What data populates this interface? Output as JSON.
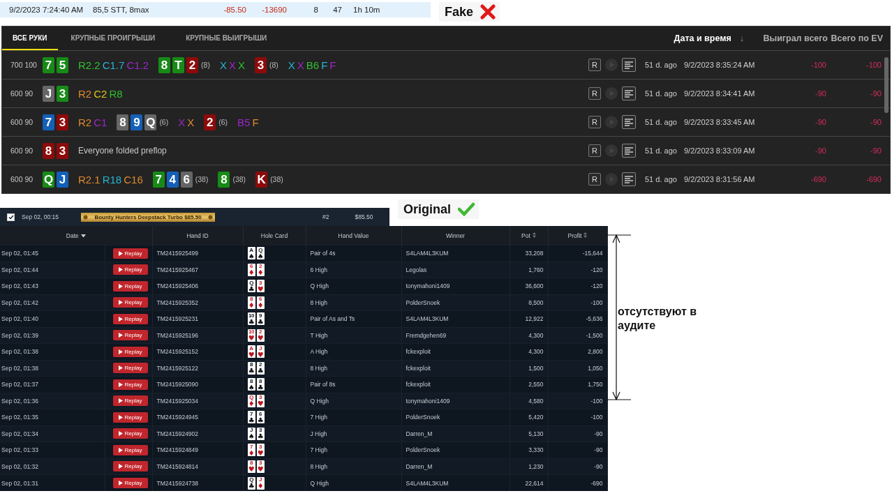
{
  "summary": {
    "date": "9/2/2023 7:24:40 AM",
    "game": "85,5 STT, 8max",
    "amount": "-85.50",
    "result": "-13690",
    "col_5": "8",
    "col_6": "47",
    "duration": "1h 10m"
  },
  "fake_label": {
    "text": "Fake",
    "kind": "cross"
  },
  "fake_panel": {
    "tabs": [
      {
        "label": "ВСЕ РУКИ",
        "selected": true
      },
      {
        "label": "КРУПНЫЕ ПРОИГРЫШИ",
        "selected": false
      },
      {
        "label": "КРУПНЫЕ ВЫИГРЫШИ",
        "selected": false
      }
    ],
    "columns": [
      {
        "label": "Дата и время",
        "sorted": true,
        "arrow": "↓"
      },
      {
        "label": "Выиграл всего",
        "sorted": false
      },
      {
        "label": "Всего по EV",
        "sorted": false
      }
    ],
    "rows": [
      {
        "stakes": "700 100",
        "streets": [
          [
            {
              "kind": "card",
              "text": "7",
              "color": "#178a17"
            },
            {
              "kind": "card",
              "text": "5",
              "color": "#178a17"
            }
          ],
          [
            {
              "kind": "action",
              "text": "R2.2",
              "color": "#2ec02e"
            },
            {
              "kind": "action",
              "text": "C1.7",
              "color": "#26b5d0"
            },
            {
              "kind": "action",
              "text": "C1.2",
              "color": "#9b27c9"
            }
          ],
          [
            {
              "kind": "card",
              "text": "8",
              "color": "#178a17"
            },
            {
              "kind": "card",
              "text": "T",
              "color": "#178a17"
            },
            {
              "kind": "card",
              "text": "2",
              "color": "#8e0a0a"
            },
            {
              "kind": "count",
              "text": "(8)"
            }
          ],
          [
            {
              "kind": "action",
              "text": "X",
              "color": "#26b5d0"
            },
            {
              "kind": "action",
              "text": "X",
              "color": "#9b27c9"
            },
            {
              "kind": "action",
              "text": "X",
              "color": "#2ec02e"
            }
          ],
          [
            {
              "kind": "card",
              "text": "3",
              "color": "#8e0a0a"
            },
            {
              "kind": "count",
              "text": "(8)"
            }
          ],
          [
            {
              "kind": "action",
              "text": "X",
              "color": "#26b5d0"
            },
            {
              "kind": "action",
              "text": "X",
              "color": "#9b27c9"
            },
            {
              "kind": "action",
              "text": "B6",
              "color": "#2ec02e"
            },
            {
              "kind": "action",
              "text": "F",
              "color": "#26b5d0"
            },
            {
              "kind": "action",
              "text": "F",
              "color": "#9b27c9"
            }
          ]
        ],
        "button": "R",
        "ago": "51 d. ago",
        "time": "9/2/2023 8:35:24 AM",
        "won": "-100",
        "ev": "-100"
      },
      {
        "stakes": "600 90",
        "streets": [
          [
            {
              "kind": "card",
              "text": "J",
              "color": "#666666"
            },
            {
              "kind": "card",
              "text": "3",
              "color": "#178a17"
            }
          ],
          [
            {
              "kind": "action",
              "text": "R2",
              "color": "#e0882e"
            },
            {
              "kind": "action",
              "text": "C2",
              "color": "#d8c620"
            },
            {
              "kind": "action",
              "text": "R8",
              "color": "#2ec02e"
            }
          ]
        ],
        "button": "R",
        "ago": "51 d. ago",
        "time": "9/2/2023 8:34:41 AM",
        "won": "-90",
        "ev": "-90"
      },
      {
        "stakes": "600 90",
        "streets": [
          [
            {
              "kind": "card",
              "text": "7",
              "color": "#1460b8"
            },
            {
              "kind": "card",
              "text": "3",
              "color": "#8e0a0a"
            }
          ],
          [
            {
              "kind": "action",
              "text": "R2",
              "color": "#e0882e"
            },
            {
              "kind": "action",
              "text": "C1",
              "color": "#9b27c9"
            }
          ],
          [
            {
              "kind": "card",
              "text": "8",
              "color": "#666666"
            },
            {
              "kind": "card",
              "text": "9",
              "color": "#1460b8"
            },
            {
              "kind": "card",
              "text": "Q",
              "color": "#666666"
            },
            {
              "kind": "count",
              "text": "(6)"
            }
          ],
          [
            {
              "kind": "action",
              "text": "X",
              "color": "#9b27c9"
            },
            {
              "kind": "action",
              "text": "X",
              "color": "#e0882e"
            }
          ],
          [
            {
              "kind": "card",
              "text": "2",
              "color": "#8e0a0a"
            },
            {
              "kind": "count",
              "text": "(6)"
            }
          ],
          [
            {
              "kind": "action",
              "text": "B5",
              "color": "#9b27c9"
            },
            {
              "kind": "action",
              "text": "F",
              "color": "#e0882e"
            }
          ]
        ],
        "button": "R",
        "ago": "51 d. ago",
        "time": "9/2/2023 8:33:45 AM",
        "won": "-90",
        "ev": "-90"
      },
      {
        "stakes": "600 90",
        "streets": [
          [
            {
              "kind": "card",
              "text": "8",
              "color": "#8e0a0a"
            },
            {
              "kind": "card",
              "text": "3",
              "color": "#8e0a0a"
            }
          ],
          [
            {
              "kind": "note",
              "text": "Everyone folded preflop"
            }
          ]
        ],
        "button": "R",
        "ago": "51 d. ago",
        "time": "9/2/2023 8:33:09 AM",
        "won": "-90",
        "ev": "-90"
      },
      {
        "stakes": "600 90",
        "streets": [
          [
            {
              "kind": "card",
              "text": "Q",
              "color": "#178a17"
            },
            {
              "kind": "card",
              "text": "J",
              "color": "#1460b8"
            }
          ],
          [
            {
              "kind": "action",
              "text": "R2.1",
              "color": "#e0882e"
            },
            {
              "kind": "action",
              "text": "R18",
              "color": "#26b5d0"
            },
            {
              "kind": "action",
              "text": "C16",
              "color": "#e0882e"
            }
          ],
          [
            {
              "kind": "card",
              "text": "7",
              "color": "#178a17"
            },
            {
              "kind": "card",
              "text": "4",
              "color": "#1460b8"
            },
            {
              "kind": "card",
              "text": "6",
              "color": "#666666"
            },
            {
              "kind": "count",
              "text": "(38)"
            }
          ],
          [
            {
              "kind": "card",
              "text": "8",
              "color": "#178a17"
            },
            {
              "kind": "count",
              "text": "(38)"
            }
          ],
          [
            {
              "kind": "card",
              "text": "K",
              "color": "#8e0a0a"
            },
            {
              "kind": "count",
              "text": "(38)"
            }
          ]
        ],
        "button": "R",
        "ago": "51 d. ago",
        "time": "9/2/2023 8:31:56 AM",
        "won": "-690",
        "ev": "-690"
      }
    ]
  },
  "original_label": {
    "text": "Original",
    "kind": "check"
  },
  "original_panel": {
    "tournament": {
      "checked": true,
      "date": "Sep 02, 00:15",
      "name": "Bounty Hunters Deepstack Turbo $85.50",
      "position": "#2",
      "buyin": "$85.50"
    },
    "columns": [
      {
        "label": "Date",
        "sorted": true,
        "sortable": true
      },
      {
        "label": "Hand ID",
        "sorted": false,
        "sortable": false
      },
      {
        "label": "Hole Card",
        "sorted": false,
        "sortable": false
      },
      {
        "label": "Hand Value",
        "sorted": false,
        "sortable": false
      },
      {
        "label": "Winner",
        "sorted": false,
        "sortable": false
      },
      {
        "label": "Pot",
        "sorted": false,
        "sortable": true
      },
      {
        "label": "Profit",
        "sorted": false,
        "sortable": true
      }
    ],
    "rows": [
      {
        "date": "Sep 02, 01:45",
        "replay": "Replay",
        "hand_id": "TM2415925499",
        "cards": [
          {
            "rank": "A",
            "suit": "♠",
            "color": "#111111"
          },
          {
            "rank": "Q",
            "suit": "♠",
            "color": "#111111"
          }
        ],
        "value": "Pair of 4s",
        "winner": "S4LAM4L3KUM",
        "pot": "33,208",
        "profit": "-15,644"
      },
      {
        "date": "Sep 02, 01:44",
        "replay": "Replay",
        "hand_id": "TM2415925467",
        "cards": [
          {
            "rank": "6",
            "suit": "♦",
            "color": "#c0161e"
          },
          {
            "rank": "2",
            "suit": "♦",
            "color": "#c0161e"
          }
        ],
        "value": "6 High",
        "winner": "Legolas",
        "pot": "1,760",
        "profit": "-120"
      },
      {
        "date": "Sep 02, 01:43",
        "replay": "Replay",
        "hand_id": "TM2415925406",
        "cards": [
          {
            "rank": "Q",
            "suit": "♣",
            "color": "#111111"
          },
          {
            "rank": "3",
            "suit": "♥",
            "color": "#c0161e"
          }
        ],
        "value": "Q High",
        "winner": "tonymahoni1409",
        "pot": "36,600",
        "profit": "-120"
      },
      {
        "date": "Sep 02, 01:42",
        "replay": "Replay",
        "hand_id": "TM2415925352",
        "cards": [
          {
            "rank": "8",
            "suit": "♦",
            "color": "#c0161e"
          },
          {
            "rank": "6",
            "suit": "♦",
            "color": "#c0161e"
          }
        ],
        "value": "8 High",
        "winner": "PolderSnoek",
        "pot": "8,500",
        "profit": "-100"
      },
      {
        "date": "Sep 02, 01:40",
        "replay": "Replay",
        "hand_id": "TM2415925231",
        "cards": [
          {
            "rank": "10",
            "suit": "♣",
            "color": "#111111"
          },
          {
            "rank": "9",
            "suit": "♣",
            "color": "#111111"
          }
        ],
        "value": "Pair of As and Ts",
        "winner": "S4LAM4L3KUM",
        "pot": "12,922",
        "profit": "-5,636"
      },
      {
        "date": "Sep 02, 01:39",
        "replay": "Replay",
        "hand_id": "TM2415925196",
        "cards": [
          {
            "rank": "10",
            "suit": "♥",
            "color": "#c0161e"
          },
          {
            "rank": "2",
            "suit": "♥",
            "color": "#c0161e"
          }
        ],
        "value": "T High",
        "winner": "Fremdgehen69",
        "pot": "4,300",
        "profit": "-1,500"
      },
      {
        "date": "Sep 02, 01:38",
        "replay": "Replay",
        "hand_id": "TM2415925152",
        "cards": [
          {
            "rank": "A",
            "suit": "♥",
            "color": "#c0161e"
          },
          {
            "rank": "J",
            "suit": "♥",
            "color": "#c0161e"
          }
        ],
        "value": "A High",
        "winner": "fckexploit",
        "pot": "4,300",
        "profit": "2,800"
      },
      {
        "date": "Sep 02, 01:38",
        "replay": "Replay",
        "hand_id": "TM2415925122",
        "cards": [
          {
            "rank": "8",
            "suit": "♣",
            "color": "#111111"
          },
          {
            "rank": "2",
            "suit": "♣",
            "color": "#111111"
          }
        ],
        "value": "8 High",
        "winner": "fckexploit",
        "pot": "1,500",
        "profit": "1,050"
      },
      {
        "date": "Sep 02, 01:37",
        "replay": "Replay",
        "hand_id": "TM2415925090",
        "cards": [
          {
            "rank": "8",
            "suit": "♠",
            "color": "#111111"
          },
          {
            "rank": "8",
            "suit": "♣",
            "color": "#111111"
          }
        ],
        "value": "Pair of 8s",
        "winner": "fckexploit",
        "pot": "2,550",
        "profit": "1,750"
      },
      {
        "date": "Sep 02, 01:36",
        "replay": "Replay",
        "hand_id": "TM2415925034",
        "cards": [
          {
            "rank": "Q",
            "suit": "♦",
            "color": "#c0161e"
          },
          {
            "rank": "3",
            "suit": "♥",
            "color": "#c0161e"
          }
        ],
        "value": "Q High",
        "winner": "tonymahoni1409",
        "pot": "4,580",
        "profit": "-100"
      },
      {
        "date": "Sep 02, 01:35",
        "replay": "Replay",
        "hand_id": "TM2415924945",
        "cards": [
          {
            "rank": "7",
            "suit": "♣",
            "color": "#111111"
          },
          {
            "rank": "6",
            "suit": "♣",
            "color": "#111111"
          }
        ],
        "value": "7 High",
        "winner": "PolderSnoek",
        "pot": "5,420",
        "profit": "-100"
      },
      {
        "date": "Sep 02, 01:34",
        "replay": "Replay",
        "hand_id": "TM2415924902",
        "cards": [
          {
            "rank": "J",
            "suit": "♠",
            "color": "#111111"
          },
          {
            "rank": "3",
            "suit": "♣",
            "color": "#111111"
          }
        ],
        "value": "J High",
        "winner": "Darren_M",
        "pot": "5,130",
        "profit": "-90"
      },
      {
        "date": "Sep 02, 01:33",
        "replay": "Replay",
        "hand_id": "TM2415924849",
        "cards": [
          {
            "rank": "7",
            "suit": "♦",
            "color": "#c0161e"
          },
          {
            "rank": "3",
            "suit": "♥",
            "color": "#c0161e"
          }
        ],
        "value": "7 High",
        "winner": "PolderSnoek",
        "pot": "3,330",
        "profit": "-90"
      },
      {
        "date": "Sep 02, 01:32",
        "replay": "Replay",
        "hand_id": "TM2415924814",
        "cards": [
          {
            "rank": "8",
            "suit": "♥",
            "color": "#c0161e"
          },
          {
            "rank": "3",
            "suit": "♥",
            "color": "#c0161e"
          }
        ],
        "value": "8 High",
        "winner": "Darren_M",
        "pot": "1,230",
        "profit": "-90"
      },
      {
        "date": "Sep 02, 01:31",
        "replay": "Replay",
        "hand_id": "TM2415924738",
        "cards": [
          {
            "rank": "Q",
            "suit": "♣",
            "color": "#111111"
          },
          {
            "rank": "J",
            "suit": "♦",
            "color": "#c0161e"
          }
        ],
        "value": "Q High",
        "winner": "S4LAM4L3KUM",
        "pot": "22,614",
        "profit": "-690"
      }
    ]
  },
  "annotation": {
    "text": "отсутствуют в аудите"
  }
}
